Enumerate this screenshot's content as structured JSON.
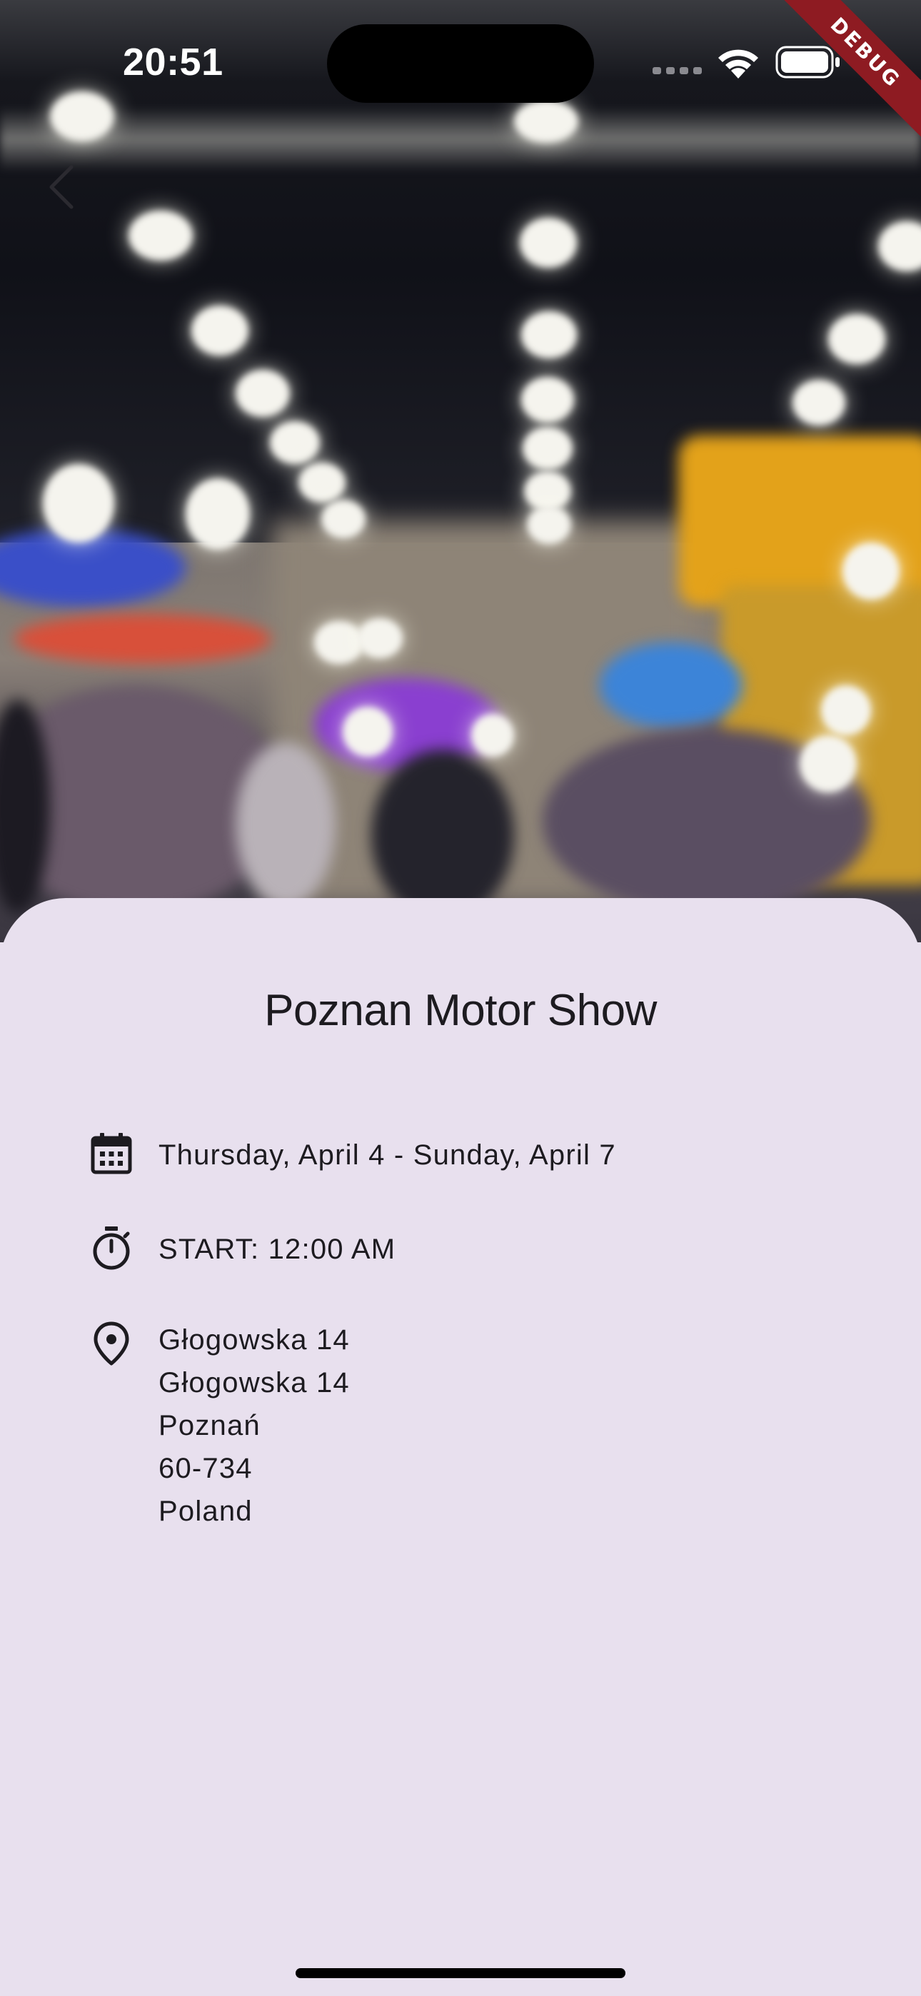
{
  "status_bar": {
    "time": "20:51"
  },
  "debug_banner": {
    "label": "DEBUG",
    "color": "#8e1b22"
  },
  "event": {
    "title": "Poznan Motor Show",
    "date_range": "Thursday, April 4 - Sunday, April 7",
    "start_time": "START: 12:00 AM",
    "address": {
      "line1": "Głogowska 14",
      "line2": "Głogowska 14",
      "city": "Poznań",
      "postal_code": "60-734",
      "country": "Poland"
    }
  },
  "icons": {
    "back": "chevron-left-icon",
    "date": "calendar-icon",
    "time": "timer-icon",
    "location": "location-pin-icon"
  },
  "colors": {
    "sheet_background": "#e8e0ee",
    "text": "#1d1b20"
  }
}
